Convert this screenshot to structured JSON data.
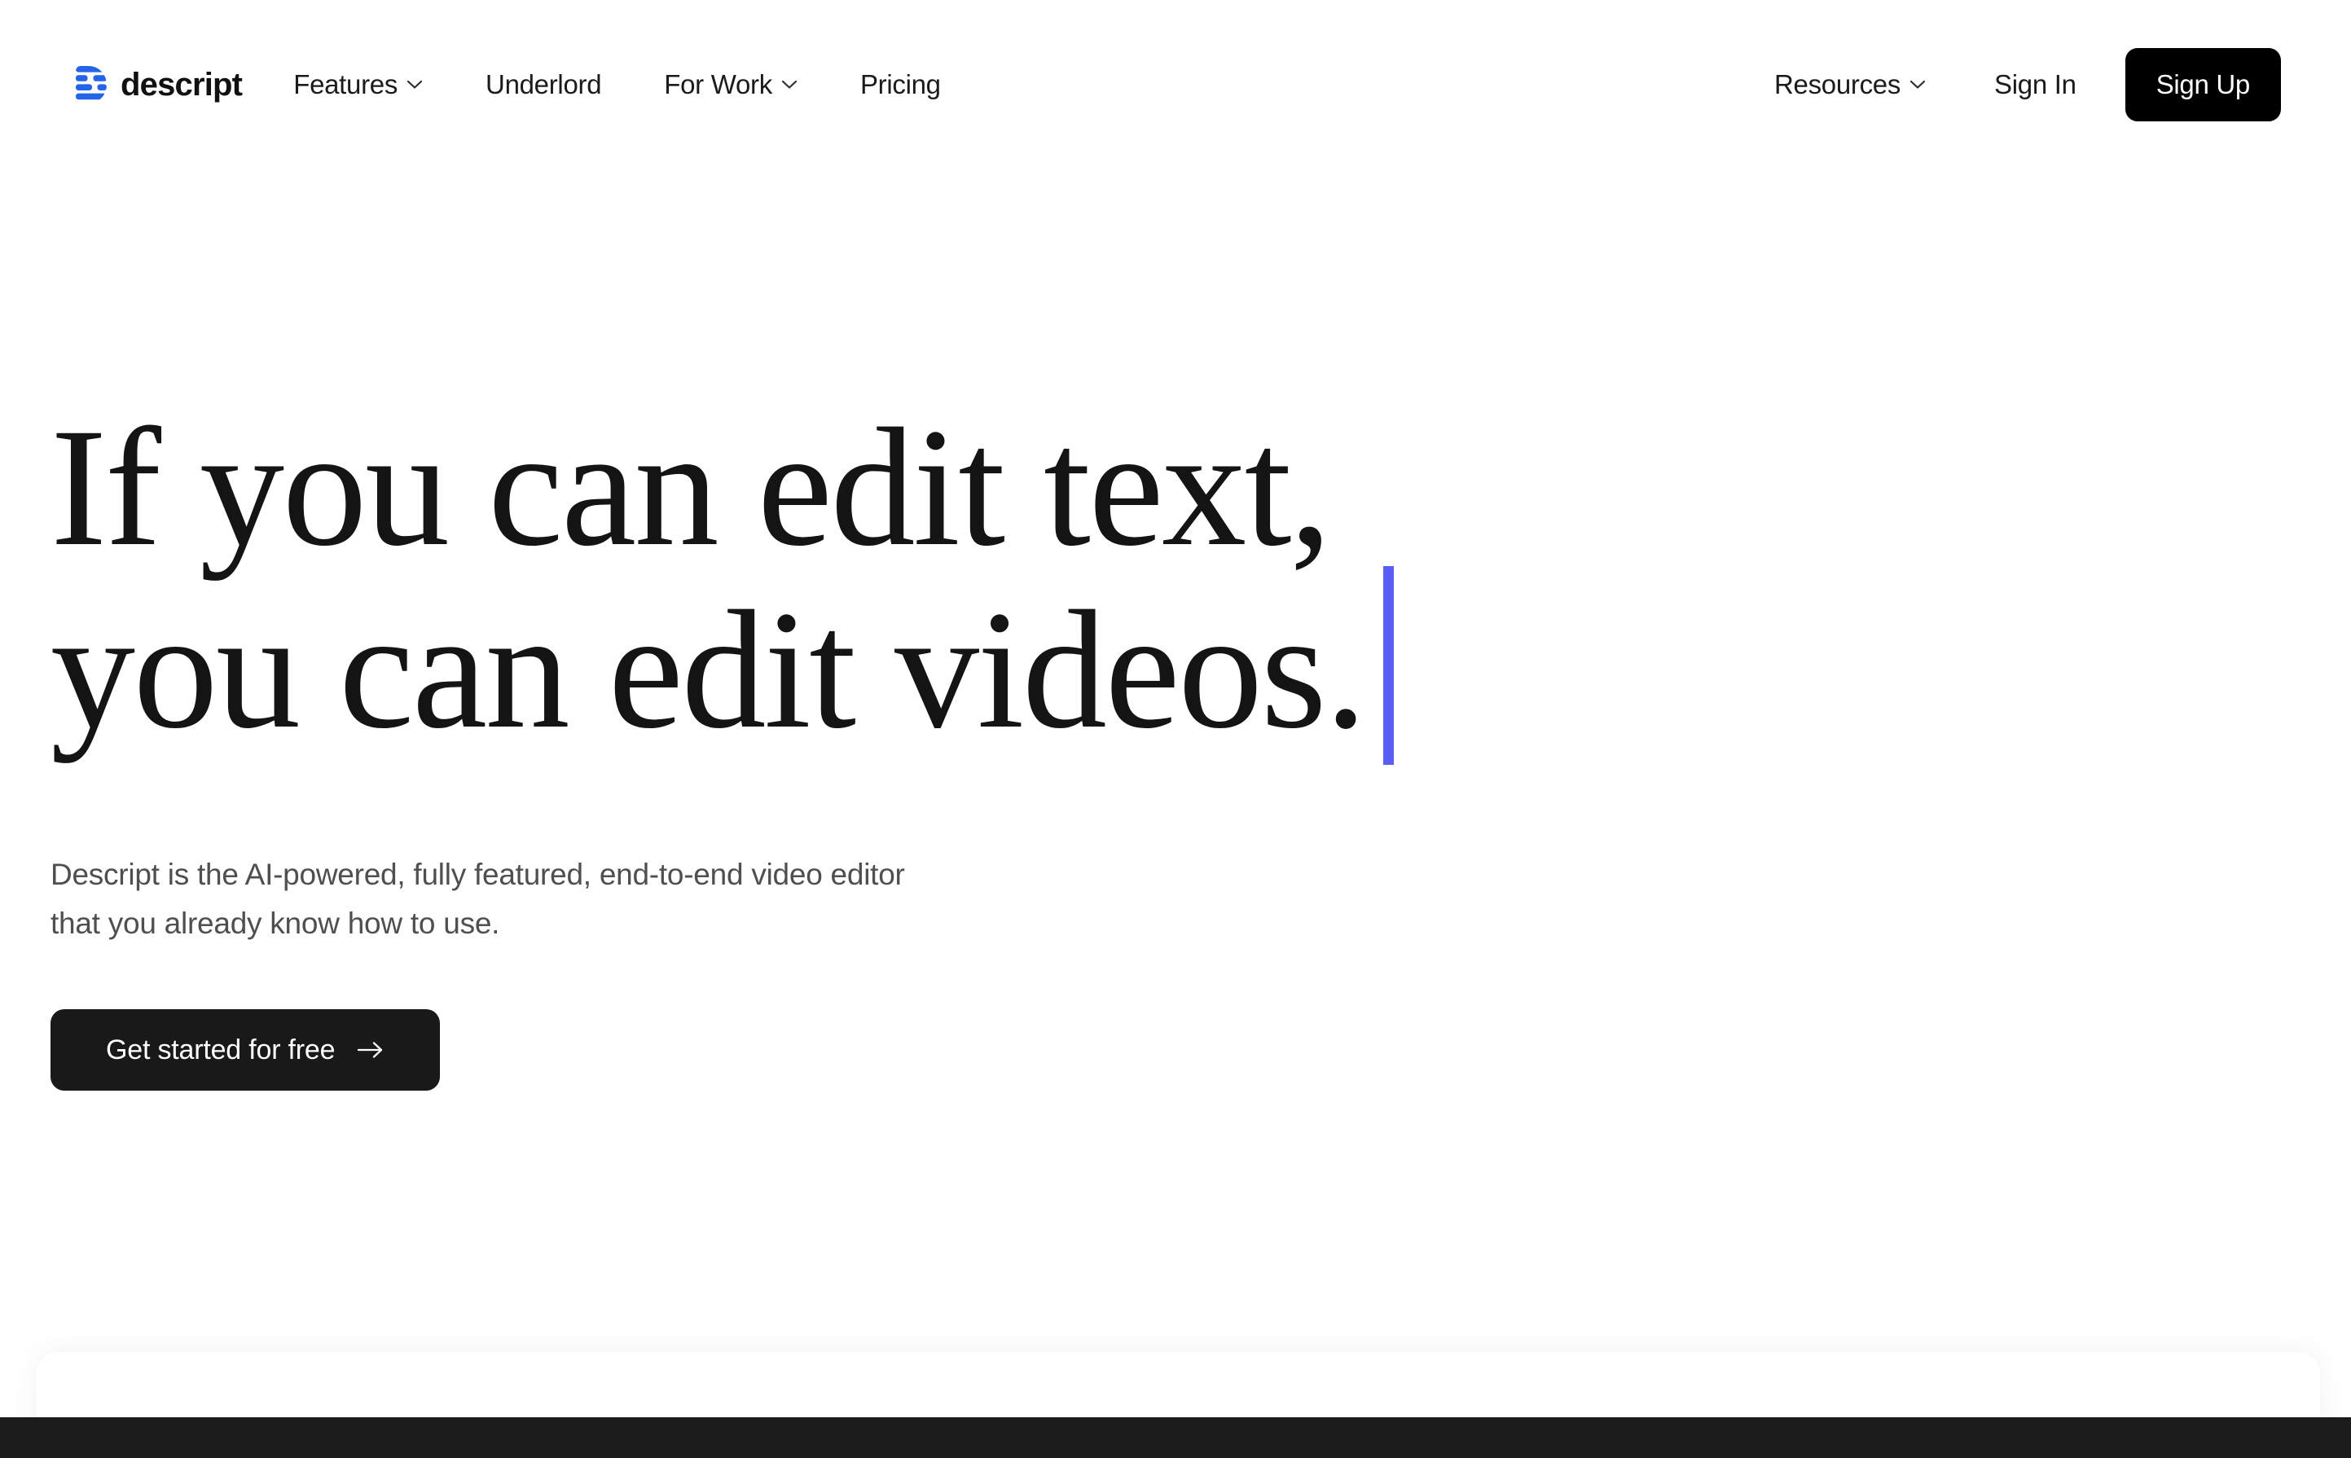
{
  "brand": {
    "name": "descript",
    "logo_icon": "descript-waveform-logo",
    "logo_color": "#2563EB"
  },
  "header": {
    "nav_left": [
      {
        "label": "Features",
        "has_dropdown": true,
        "icon": "chevron-down-icon"
      },
      {
        "label": "Underlord",
        "has_dropdown": false
      },
      {
        "label": "For Work",
        "has_dropdown": true,
        "icon": "chevron-down-icon"
      },
      {
        "label": "Pricing",
        "has_dropdown": false
      }
    ],
    "nav_right": [
      {
        "label": "Resources",
        "has_dropdown": true,
        "icon": "chevron-down-icon"
      }
    ],
    "sign_in_label": "Sign In",
    "sign_up_label": "Sign Up",
    "sign_up_bg": "#000000",
    "text_color": "#1B1B1B"
  },
  "hero": {
    "headline_line_1": "If you can edit text,",
    "headline_line_2": "you can edit videos.",
    "cursor_color": "#5B5EF5",
    "cursor_icon": "text-cursor-caret",
    "subheading_line_1": "Descript is the AI-powered, fully featured, end-to-end video editor",
    "subheading_line_2": "that you already know how to use.",
    "subheading_color": "#4F4F4F",
    "cta_label": "Get started for free",
    "cta_icon": "arrow-right-icon",
    "cta_bg": "#191919"
  },
  "bottom": {
    "card_bg": "#FFFFFF",
    "bar_bg": "#1B1B1B"
  }
}
